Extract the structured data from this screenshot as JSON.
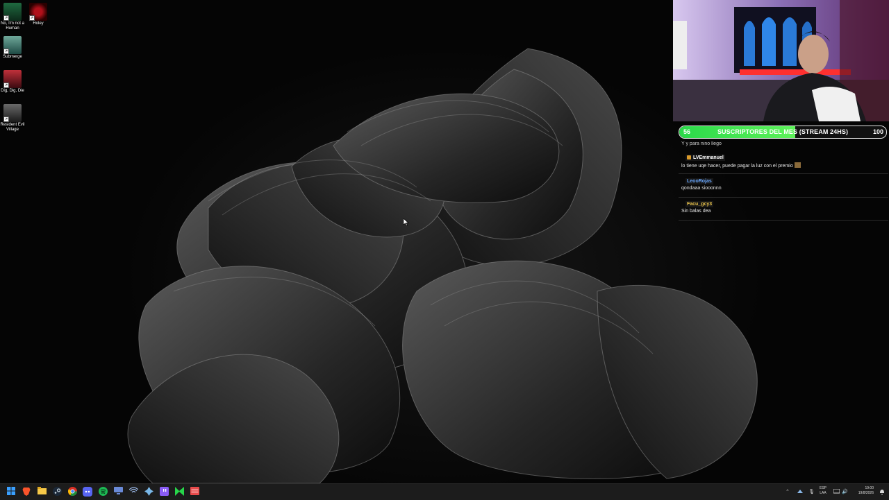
{
  "desktop": {
    "icons": [
      {
        "label": "No, I'm not a Human",
        "icon": "no-im-not-a-human-icon"
      },
      {
        "label": "Holey",
        "icon": "holey-icon"
      },
      {
        "label": "Submerge",
        "icon": "submerge-icon"
      },
      {
        "label": "Dig, Dig, Die",
        "icon": "dig-dig-die-icon"
      },
      {
        "label": "Resident Evil Village",
        "icon": "resident-evil-village-icon"
      }
    ]
  },
  "overlay": {
    "sub_goal": {
      "current": "56",
      "title": "SUSCRIPTORES DEL MES (STREAM 24HS)",
      "target": "100",
      "progress": 0.56,
      "color": "#3fe04f"
    },
    "chat": {
      "cut_text": "Y y para nino llego",
      "messages": [
        {
          "user": "LVEmmanuel",
          "user_color": "#ffffff",
          "text": "lo tiene uqe hacer, puede pagar la luz con el premio",
          "badge": "subscriber-badge-icon"
        },
        {
          "user": "LeooRojas",
          "user_color": "#6aa8ff",
          "text": "qondaaa siooonnn"
        },
        {
          "user": "Facu_gcy3",
          "user_color": "#e8c24a",
          "text": "Sin balas dea"
        }
      ]
    }
  },
  "taskbar": {
    "apps": [
      "windows-start-icon",
      "brave-browser-icon",
      "file-explorer-icon",
      "steam-icon",
      "chrome-icon",
      "discord-icon",
      "spotify-icon",
      "screen-icon",
      "network-icon",
      "launcher-icon",
      "twitch-icon",
      "obs-green-icon",
      "calendar-icon"
    ],
    "language": {
      "line1": "ESP",
      "line2": "LAA"
    },
    "clock": {
      "time": "19:00",
      "date": "19/8/2026"
    },
    "tray_icons": [
      "chevron-up-icon",
      "onedrive-icon",
      "microphone-icon",
      "display-icon",
      "speaker-icon",
      "notification-icon"
    ]
  }
}
